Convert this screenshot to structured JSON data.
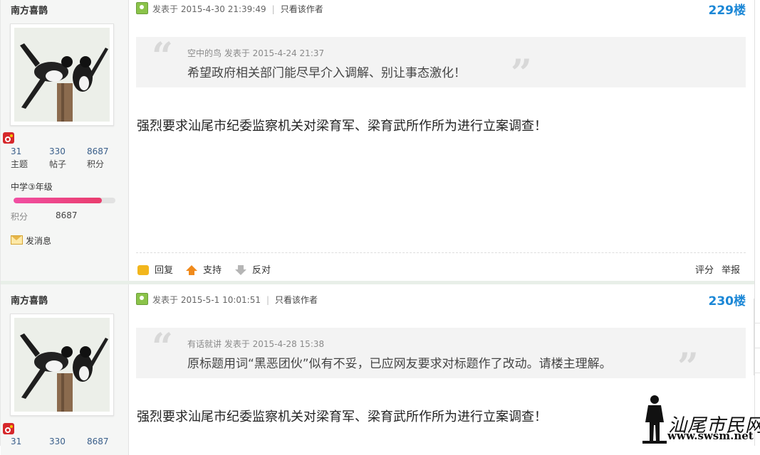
{
  "posts": [
    {
      "author": "南方喜鹊",
      "stats": [
        {
          "num": "31",
          "label": "主题"
        },
        {
          "num": "330",
          "label": "帖子"
        },
        {
          "num": "8687",
          "label": "积分"
        }
      ],
      "level": "中学③年级",
      "level_progress": 0.87,
      "points_label": "积分",
      "points_value": "8687",
      "send_message": "发消息",
      "posted": "发表于 2015-4-30 21:39:49",
      "only_author": "只看该作者",
      "floor": "229楼",
      "quote_head": "空中的鸟 发表于 2015-4-24 21:37",
      "quote_text": "希望政府相关部门能尽早介入调解、别让事态激化！",
      "body": "强烈要求汕尾市纪委监察机关对梁育军、梁育武所作所为进行立案调查！",
      "actions": {
        "reply": "回复",
        "support": "支持",
        "oppose": "反对",
        "rate": "评分",
        "report": "举报"
      }
    },
    {
      "author": "南方喜鹊",
      "stats": [
        {
          "num": "31",
          "label": "主题"
        },
        {
          "num": "330",
          "label": "帖子"
        },
        {
          "num": "8687",
          "label": "积分"
        }
      ],
      "posted": "发表于 2015-5-1 10:01:51",
      "only_author": "只看该作者",
      "floor": "230楼",
      "quote_head": "有话就讲 发表于 2015-4-28 15:38",
      "quote_text": "原标题用词“黑恶团伙”似有不妥，已应网友要求对标题作了改动。请楼主理解。",
      "body": "强烈要求汕尾市纪委监察机关对梁育军、梁育武所作所为进行立案调查！"
    }
  ],
  "watermark": {
    "text": "汕尾市民网",
    "url": "www.swsm.net"
  },
  "colors": {
    "floor": "#1b87d6",
    "level_bar": "#f14fa3",
    "sidebar": "#f5f6f5"
  }
}
